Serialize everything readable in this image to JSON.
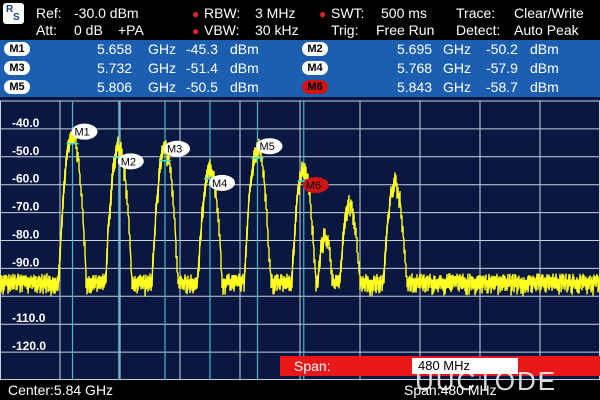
{
  "header": {
    "ref_label": "Ref:",
    "ref_value": "-30.0 dBm",
    "att_label": "Att:",
    "att_value": "0 dB",
    "preamp": "+PA",
    "rbw_label": "RBW:",
    "rbw_value": "3 MHz",
    "vbw_label": "VBW:",
    "vbw_value": "30 kHz",
    "swt_label": "SWT:",
    "swt_value": "500 ms",
    "trig_label": "Trig:",
    "trig_value": "Free Run",
    "trace_label": "Trace:",
    "trace_value": "Clear/Write",
    "detect_label": "Detect:",
    "detect_value": "Auto Peak",
    "logo_top": "R",
    "logo_bottom": "S"
  },
  "markers": [
    {
      "name": "M1",
      "freq": "5.658",
      "freq_unit": "GHz",
      "level": "-45.3",
      "level_unit": "dBm"
    },
    {
      "name": "M2",
      "freq": "5.695",
      "freq_unit": "GHz",
      "level": "-50.2",
      "level_unit": "dBm"
    },
    {
      "name": "M3",
      "freq": "5.732",
      "freq_unit": "GHz",
      "level": "-51.4",
      "level_unit": "dBm"
    },
    {
      "name": "M4",
      "freq": "5.768",
      "freq_unit": "GHz",
      "level": "-57.9",
      "level_unit": "dBm"
    },
    {
      "name": "M5",
      "freq": "5.806",
      "freq_unit": "GHz",
      "level": "-50.5",
      "level_unit": "dBm"
    },
    {
      "name": "M6",
      "freq": "5.843",
      "freq_unit": "GHz",
      "level": "-58.7",
      "level_unit": "dBm"
    }
  ],
  "y_axis": [
    "-40.0",
    "-50.0",
    "-60.0",
    "-70.0",
    "-80.0",
    "-90.0",
    "-110.0",
    "-120.0"
  ],
  "footer": {
    "center": "Center:5.84 GHz",
    "span_label": "Span:",
    "span_value": "480 MHz",
    "span_footer": "Span:480 MHz"
  },
  "watermark": "UUCTODE",
  "colors": {
    "trace": "#ffff20",
    "marker_bar": "#1c5fb0",
    "screen": "#0a1740",
    "grid": "#c8d0e0",
    "marker_line": "#40b8c8",
    "active_marker": "#d01414"
  },
  "chart_data": {
    "type": "line",
    "xlabel": "",
    "ylabel": "",
    "ylim": [
      -130,
      -30
    ],
    "y_ticks": [
      -40,
      -50,
      -60,
      -70,
      -80,
      -90,
      -100,
      -110,
      -120
    ],
    "x_range_ghz": [
      5.6,
      6.08
    ],
    "peaks": [
      {
        "x": 5.658,
        "y": -45.3
      },
      {
        "x": 5.695,
        "y": -50.2
      },
      {
        "x": 5.732,
        "y": -51.4
      },
      {
        "x": 5.768,
        "y": -57.9
      },
      {
        "x": 5.806,
        "y": -50.5
      },
      {
        "x": 5.843,
        "y": -58.7
      },
      {
        "x": 5.86,
        "y": -83
      },
      {
        "x": 5.88,
        "y": -71
      },
      {
        "x": 5.916,
        "y": -63
      }
    ],
    "noise_floor": -93
  }
}
